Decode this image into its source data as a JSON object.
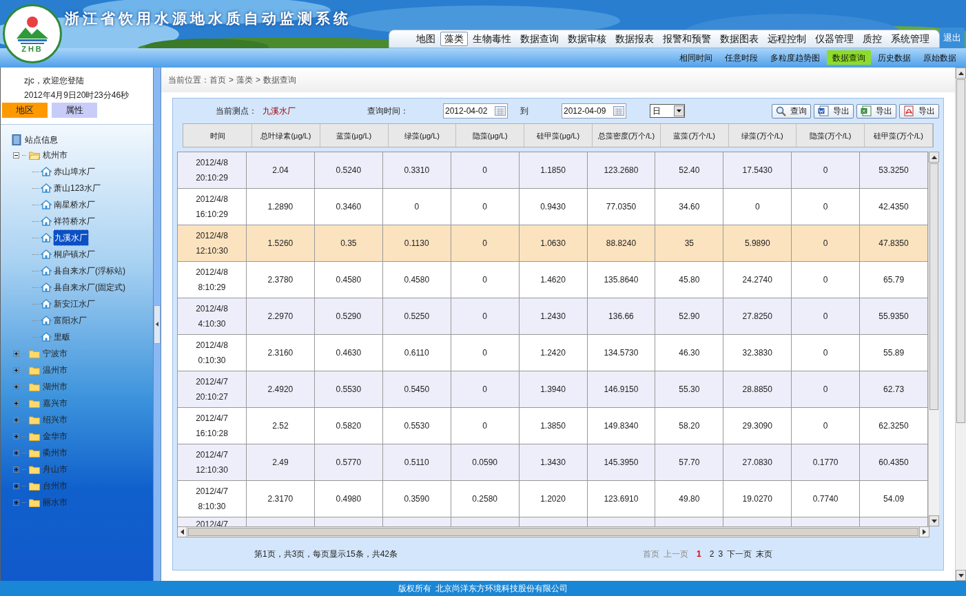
{
  "header": {
    "title": "浙江省饮用水源地水质自动监测系统",
    "logo_text": "ZHB",
    "logout": "退出"
  },
  "nav_tabs": [
    {
      "label": "地图",
      "selected": false
    },
    {
      "label": "藻类",
      "selected": true
    },
    {
      "label": "生物毒性",
      "selected": false
    },
    {
      "label": "数据查询",
      "selected": false
    },
    {
      "label": "数据审核",
      "selected": false
    },
    {
      "label": "数据报表",
      "selected": false
    },
    {
      "label": "报警和预警",
      "selected": false
    },
    {
      "label": "数据图表",
      "selected": false
    },
    {
      "label": "远程控制",
      "selected": false
    },
    {
      "label": "仪器管理",
      "selected": false
    },
    {
      "label": "质控",
      "selected": false
    },
    {
      "label": "系统管理",
      "selected": false
    }
  ],
  "sub_nav": [
    {
      "label": "相同时间",
      "selected": false
    },
    {
      "label": "任意时段",
      "selected": false
    },
    {
      "label": "多粒度趋势图",
      "selected": false
    },
    {
      "label": "数据查询",
      "selected": true
    },
    {
      "label": "历史数据",
      "selected": false
    },
    {
      "label": "原始数据",
      "selected": false
    }
  ],
  "sidebar": {
    "welcome": "zjc，欢迎您登陆",
    "datetime": "2012年4月9日20时23分46秒",
    "tabs": [
      {
        "label": "地区",
        "selected": true
      },
      {
        "label": "属性",
        "selected": false
      }
    ],
    "tree_title": "站点信息",
    "tree": [
      {
        "label": "杭州市",
        "expanded": true,
        "children": [
          {
            "label": "赤山埠水厂",
            "selected": false
          },
          {
            "label": "萧山123水厂",
            "selected": false
          },
          {
            "label": "南星桥水厂",
            "selected": false
          },
          {
            "label": "祥符桥水厂",
            "selected": false
          },
          {
            "label": "九溪水厂",
            "selected": true
          },
          {
            "label": "桐庐镇水厂",
            "selected": false
          },
          {
            "label": "县自来水厂(浮标站)",
            "selected": false
          },
          {
            "label": "县自来水厂(固定式)",
            "selected": false
          },
          {
            "label": "新安江水厂",
            "selected": false
          },
          {
            "label": "富阳水厂",
            "selected": false
          },
          {
            "label": "里畈",
            "selected": false
          }
        ]
      },
      {
        "label": "宁波市",
        "expanded": false
      },
      {
        "label": "温州市",
        "expanded": false
      },
      {
        "label": "湖州市",
        "expanded": false
      },
      {
        "label": "嘉兴市",
        "expanded": false
      },
      {
        "label": "绍兴市",
        "expanded": false
      },
      {
        "label": "金华市",
        "expanded": false
      },
      {
        "label": "衢州市",
        "expanded": false
      },
      {
        "label": "舟山市",
        "expanded": false
      },
      {
        "label": "台州市",
        "expanded": false
      },
      {
        "label": "丽水市",
        "expanded": false
      }
    ]
  },
  "breadcrumb": [
    "当前位置：首页",
    ">",
    "藻类",
    ">",
    "数据查询"
  ],
  "query": {
    "station_label": "当前测点：",
    "station": "九溪水厂",
    "time_label": "查询时间：",
    "start": "2012-04-02",
    "to": "到",
    "end": "2012-04-09",
    "period": "日",
    "buttons": [
      {
        "label": "查询",
        "kind": "search"
      },
      {
        "label": "导出",
        "kind": "word"
      },
      {
        "label": "导出",
        "kind": "excel"
      },
      {
        "label": "导出",
        "kind": "pdf"
      }
    ]
  },
  "table": {
    "columns": [
      "时间",
      "总叶绿素(μg/L)",
      "蓝藻(μg/L)",
      "绿藻(μg/L)",
      "隐藻(μg/L)",
      "硅甲藻(μg/L)",
      "总藻密度(万个/L)",
      "蓝藻(万个/L)",
      "绿藻(万个/L)",
      "隐藻(万个/L)",
      "硅甲藻(万个/L)"
    ],
    "rows": [
      {
        "date": "2012/4/8",
        "time": "20:10:29",
        "values": [
          "2.04",
          "0.5240",
          "0.3310",
          "0",
          "1.1850",
          "123.2680",
          "52.40",
          "17.5430",
          "0",
          "53.3250"
        ],
        "selected": false
      },
      {
        "date": "2012/4/8",
        "time": "16:10:29",
        "values": [
          "1.2890",
          "0.3460",
          "0",
          "0",
          "0.9430",
          "77.0350",
          "34.60",
          "0",
          "0",
          "42.4350"
        ],
        "selected": false
      },
      {
        "date": "2012/4/8",
        "time": "12:10:30",
        "values": [
          "1.5260",
          "0.35",
          "0.1130",
          "0",
          "1.0630",
          "88.8240",
          "35",
          "5.9890",
          "0",
          "47.8350"
        ],
        "selected": true
      },
      {
        "date": "2012/4/8",
        "time": "8:10:29",
        "values": [
          "2.3780",
          "0.4580",
          "0.4580",
          "0",
          "1.4620",
          "135.8640",
          "45.80",
          "24.2740",
          "0",
          "65.79"
        ],
        "selected": false
      },
      {
        "date": "2012/4/8",
        "time": "4:10:30",
        "values": [
          "2.2970",
          "0.5290",
          "0.5250",
          "0",
          "1.2430",
          "136.66",
          "52.90",
          "27.8250",
          "0",
          "55.9350"
        ],
        "selected": false
      },
      {
        "date": "2012/4/8",
        "time": "0:10:30",
        "values": [
          "2.3160",
          "0.4630",
          "0.6110",
          "0",
          "1.2420",
          "134.5730",
          "46.30",
          "32.3830",
          "0",
          "55.89"
        ],
        "selected": false
      },
      {
        "date": "2012/4/7",
        "time": "20:10:27",
        "values": [
          "2.4920",
          "0.5530",
          "0.5450",
          "0",
          "1.3940",
          "146.9150",
          "55.30",
          "28.8850",
          "0",
          "62.73"
        ],
        "selected": false
      },
      {
        "date": "2012/4/7",
        "time": "16:10:28",
        "values": [
          "2.52",
          "0.5820",
          "0.5530",
          "0",
          "1.3850",
          "149.8340",
          "58.20",
          "29.3090",
          "0",
          "62.3250"
        ],
        "selected": false
      },
      {
        "date": "2012/4/7",
        "time": "12:10:30",
        "values": [
          "2.49",
          "0.5770",
          "0.5110",
          "0.0590",
          "1.3430",
          "145.3950",
          "57.70",
          "27.0830",
          "0.1770",
          "60.4350"
        ],
        "selected": false
      },
      {
        "date": "2012/4/7",
        "time": "8:10:30",
        "values": [
          "2.3170",
          "0.4980",
          "0.3590",
          "0.2580",
          "1.2020",
          "123.6910",
          "49.80",
          "19.0270",
          "0.7740",
          "54.09"
        ],
        "selected": false
      },
      {
        "date": "2012/4/7",
        "selected": false
      }
    ]
  },
  "pager": {
    "summary": "第1页，共3页，每页显示15条，共42条",
    "links": [
      {
        "label": "首页",
        "kind": "disabled"
      },
      {
        "label": "上一页",
        "kind": "disabled"
      },
      {
        "label": "1",
        "kind": "current"
      },
      {
        "label": "2",
        "kind": "page"
      },
      {
        "label": "3",
        "kind": "page"
      },
      {
        "label": "下一页",
        "kind": "link"
      },
      {
        "label": "末页",
        "kind": "link"
      }
    ]
  },
  "footer": "版权所有  北京尚洋东方环境科技股份有限公司"
}
